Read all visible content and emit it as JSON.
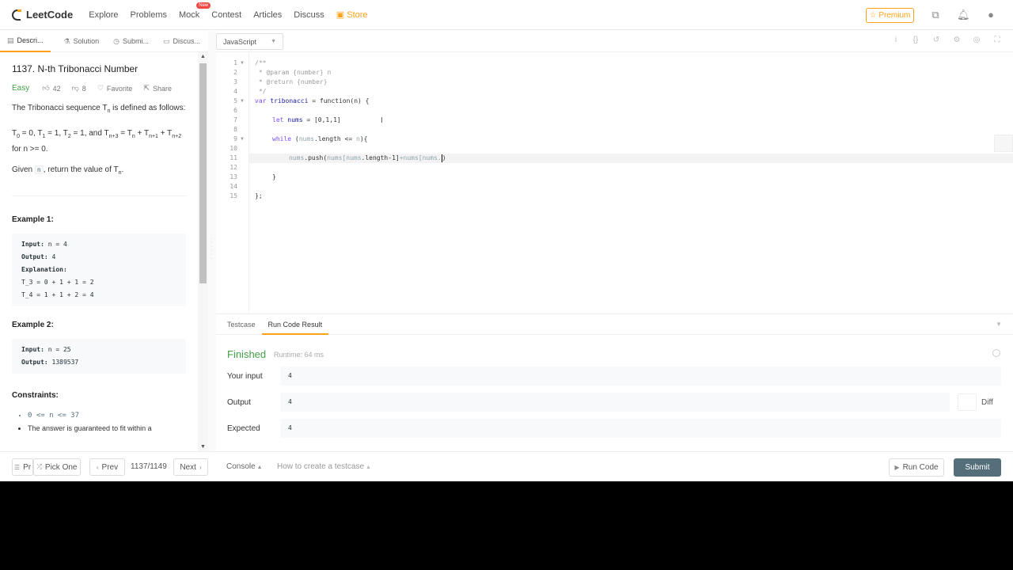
{
  "nav": {
    "logo": "LeetCode",
    "items": [
      "Explore",
      "Problems",
      "Mock",
      "Contest",
      "Articles",
      "Discuss",
      "Store"
    ],
    "new_badge": "New",
    "premium": "Premium",
    "icons": [
      "playground-icon",
      "bell-icon",
      "avatar-icon"
    ]
  },
  "left_tabs": [
    {
      "label": "Descri...",
      "icon": "description-icon"
    },
    {
      "label": "Solution",
      "icon": "flask-icon"
    },
    {
      "label": "Submi...",
      "icon": "clock-icon"
    },
    {
      "label": "Discus...",
      "icon": "discuss-icon"
    }
  ],
  "problem": {
    "title": "1137. N-th Tribonacci Number",
    "difficulty": "Easy",
    "likes": "42",
    "dislikes": "8",
    "favorite": "Favorite",
    "share": "Share",
    "desc1_a": "The Tribonacci sequence T",
    "desc1_sub": "n",
    "desc1_b": " is defined as follows:",
    "desc2": "T<sub>0</sub> = 0, T<sub>1</sub> = 1, T<sub>2</sub> = 1, and T<sub>n+3</sub> = T<sub>n</sub> + T<sub>n+1</sub> + T<sub>n+2</sub> for n >= 0.",
    "desc3_a": "Given ",
    "desc3_code": "n",
    "desc3_b": ", return the value of T",
    "desc3_sub": "n",
    "desc3_c": ".",
    "example1_title": "Example 1:",
    "example1": {
      "input_label": "Input:",
      "input": " n = 4",
      "output_label": "Output:",
      "output": " 4",
      "explanation_label": "Explanation:",
      "line1": "T_3 = 0 + 1 + 1 = 2",
      "line2": "T_4 = 1 + 1 + 2 = 4"
    },
    "example2_title": "Example 2:",
    "example2": {
      "input_label": "Input:",
      "input": " n = 25",
      "output_label": "Output:",
      "output": " 1389537"
    },
    "constraints_title": "Constraints:",
    "constraint1": "0 <= n <= 37",
    "constraint2": "The answer is guaranteed to fit within a"
  },
  "editor": {
    "language": "JavaScript",
    "toolbar_icons": [
      "info-icon",
      "braces-icon",
      "reset-icon",
      "settings-icon",
      "fullscreen-icon"
    ],
    "line_numbers": [
      "1",
      "2",
      "3",
      "4",
      "5",
      "6",
      "7",
      "8",
      "9",
      "10",
      "11",
      "12",
      "13",
      "14",
      "15"
    ],
    "lines": {
      "l1": "/**",
      "l2": " * @param {number} n",
      "l3": " * @return {number}",
      "l4": " */",
      "l5_kw": "var ",
      "l5_name": "tribonacci",
      "l5_rest": " = function(n) {",
      "l7_kw": "let ",
      "l7_var": "nums",
      "l7_rest": " = [0,1,1]",
      "l9_kw": "while ",
      "l9_rest_a": "(",
      "l9_var": "nums",
      "l9_rest_b": ".length <= ",
      "l9_n": "n",
      "l9_rest_c": "){",
      "l11_a": "nums",
      "l11_b": ".push(",
      "l11_c": "nums[nums",
      "l11_d": ".length-1]",
      "l11_e": "+nums[nums.",
      "l11_f": ")",
      "l13": "}",
      "l15": "};"
    }
  },
  "result": {
    "tabs": [
      "Testcase",
      "Run Code Result"
    ],
    "status": "Finished",
    "runtime": "Runtime: 64 ms",
    "your_input_label": "Your input",
    "your_input": "4",
    "output_label": "Output",
    "output": "4",
    "expected_label": "Expected",
    "expected": "4",
    "diff": "Diff"
  },
  "bottom": {
    "problems": "Pr",
    "pick_one": "Pick One",
    "prev": "Prev",
    "counter": "1137/1149",
    "next": "Next",
    "console": "Console",
    "howto": "How to create a testcase",
    "run_code": "Run Code",
    "submit": "Submit"
  },
  "colors": {
    "accent": "#ffa116",
    "easy": "#43a047",
    "submit": "#546e7a"
  }
}
